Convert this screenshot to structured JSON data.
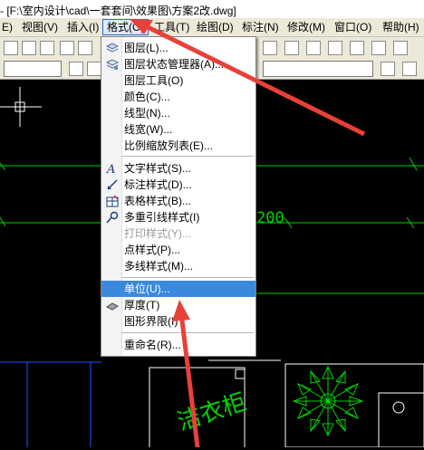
{
  "title": "- [F:\\室内设计\\cad\\一套套间\\效果图\\方案2改.dwg]",
  "menubar": [
    "E)",
    "视图(V)",
    "插入(I)",
    "格式(O)",
    "工具(T)",
    "绘图(D)",
    "标注(N)",
    "修改(M)",
    "窗口(O)",
    "帮助(H)"
  ],
  "dropdown": {
    "items": [
      {
        "label": "图层(L)...",
        "icon": "layers-icon",
        "enabled": true
      },
      {
        "label": "图层状态管理器(A)...",
        "icon": "layer-state-icon",
        "enabled": true
      },
      {
        "label": "图层工具(O)",
        "icon": "",
        "enabled": true
      },
      {
        "label": "颜色(C)...",
        "icon": "",
        "enabled": true
      },
      {
        "label": "线型(N)...",
        "icon": "",
        "enabled": true
      },
      {
        "label": "线宽(W)...",
        "icon": "",
        "enabled": true
      },
      {
        "label": "比例缩放列表(E)...",
        "icon": "",
        "enabled": true
      },
      {
        "label": "文字样式(S)...",
        "icon": "text-style-icon",
        "enabled": true
      },
      {
        "label": "标注样式(D)...",
        "icon": "dim-style-icon",
        "enabled": true
      },
      {
        "label": "表格样式(B)...",
        "icon": "table-style-icon",
        "enabled": true
      },
      {
        "label": "多重引线样式(I)",
        "icon": "multileader-icon",
        "enabled": true
      },
      {
        "label": "打印样式(Y)...",
        "icon": "",
        "enabled": false
      },
      {
        "label": "点样式(P)...",
        "icon": "",
        "enabled": true
      },
      {
        "label": "多线样式(M)...",
        "icon": "",
        "enabled": true
      },
      {
        "label": "单位(U)...",
        "icon": "",
        "enabled": true,
        "highlighted": true
      },
      {
        "label": "厚度(T)",
        "icon": "thickness-icon",
        "enabled": true
      },
      {
        "label": "图形界限(I)",
        "icon": "",
        "enabled": true
      },
      {
        "label": "重命名(R)...",
        "icon": "",
        "enabled": true
      }
    ]
  },
  "canvas": {
    "dimension_text": "200",
    "watermark_text": "洁衣柜"
  },
  "colors": {
    "arrow": "#e8403a",
    "cad_green": "#00d400",
    "highlight": "#3b89dc"
  }
}
